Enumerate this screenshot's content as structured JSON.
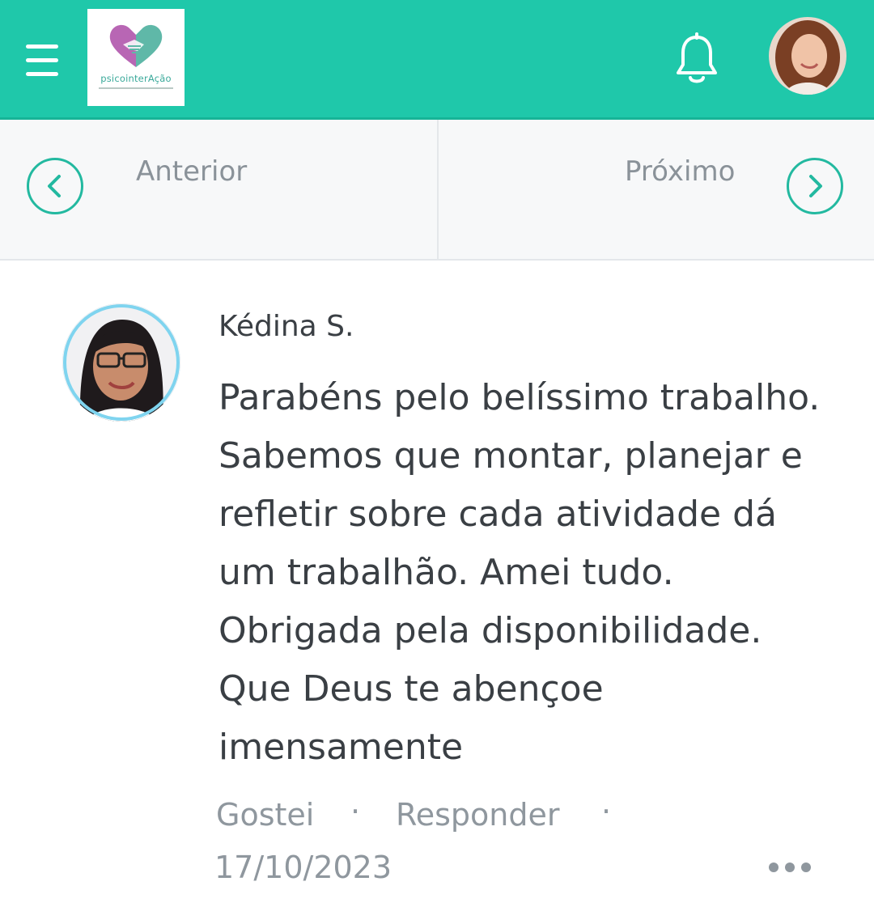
{
  "header": {
    "logo_text": "psicointerAção",
    "menu_icon": "hamburger-icon",
    "bell_icon": "bell-icon"
  },
  "navigation": {
    "prev_label": "Anterior",
    "next_label": "Próximo"
  },
  "comment": {
    "author": "Kédina S.",
    "text": "Parabéns pelo belíssimo trabalho. Sabemos que montar, planejar e refletir sobre cada atividade dá um trabalhão. Amei tudo. Obrigada pela disponibilidade. Que Deus te abençoe imensamente",
    "like_label": "Gostei",
    "reply_label": "Responder",
    "separator": "·",
    "date": "17/10/2023"
  },
  "colors": {
    "header_bg": "#1fc8aa",
    "accent": "#23b9a0",
    "muted_text": "#8f979e",
    "body_text": "#3a3f44"
  }
}
